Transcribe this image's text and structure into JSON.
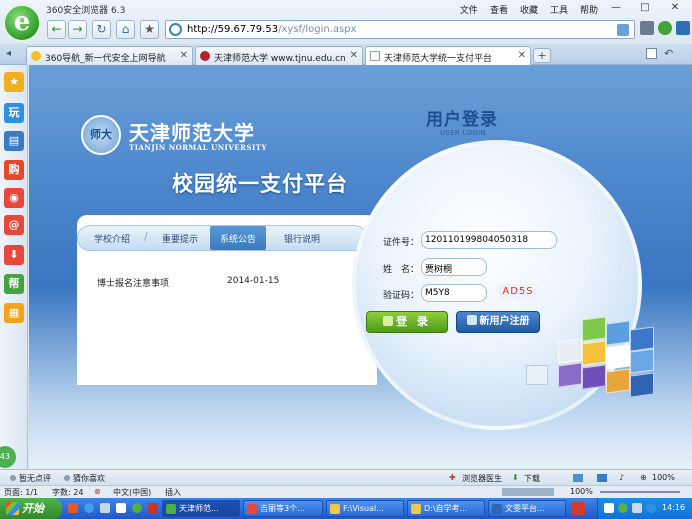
{
  "browser": {
    "app_name": "360安全浏览器 6.3",
    "logo_glyph": "e",
    "menus": [
      "文件",
      "查看",
      "收藏",
      "工具",
      "帮助"
    ],
    "win_buttons": [
      "—",
      "□",
      "✕"
    ],
    "url_host": "http://59.67.79.53",
    "url_path": "/xysf/login.aspx",
    "nav_glyphs": {
      "back": "←",
      "forward": "→",
      "refresh": "↻",
      "home": "⌂",
      "favorite": "★"
    }
  },
  "tabs": [
    {
      "label": "360导航_新一代安全上网导航",
      "close": "✕"
    },
    {
      "label": "天津师范大学 www.tjnu.edu.cn",
      "close": "✕"
    },
    {
      "label": "天津师范大学统一支付平台",
      "close": "✕"
    }
  ],
  "newtab_label": "+",
  "sidebar": {
    "items": [
      {
        "glyph": "★",
        "color": "#f2b01e"
      },
      {
        "glyph": "玩",
        "color": "#2f8fe0"
      },
      {
        "glyph": "▤",
        "color": "#3a7bc2"
      },
      {
        "glyph": "购",
        "color": "#e14b2b"
      },
      {
        "glyph": "◉",
        "color": "#e8483b"
      },
      {
        "glyph": "@",
        "color": "#e8483b"
      },
      {
        "glyph": "⬇",
        "color": "#e8483b"
      },
      {
        "glyph": "帮",
        "color": "#45a33d"
      },
      {
        "glyph": "▦",
        "color": "#f2a21e"
      }
    ],
    "badge": "43"
  },
  "page": {
    "emblem_text": "师大",
    "brand_cn": "天津师范大学",
    "brand_en": "TIANJIN NORMAL UNIVERSITY",
    "system_title": "校园统一支付平台",
    "panel_tabs": [
      "学校介绍",
      "重要提示",
      "系统公告",
      "银行说明"
    ],
    "panel_tab_separator": "/",
    "notices": [
      {
        "title": "博士报名注意事项",
        "date": "2014-01-15"
      }
    ]
  },
  "login": {
    "title": "用户登录",
    "subtitle": "USER LOGIN",
    "id_label": "证件号：",
    "id_value": "120110199804050318",
    "name_label": "姓　名：",
    "name_value": "贾树桐",
    "code_label": "验证码：",
    "code_value": "M5Y8",
    "captcha_text": "AD5S",
    "login_button": "登 录",
    "register_button": "新用户注册"
  },
  "statusbar": {
    "left1": "暂无点评",
    "left2": "猜你喜欢",
    "doctor": "浏览器医生",
    "download": "下载",
    "zoom": "100%"
  },
  "docbar": {
    "page": "页面: 1/1",
    "words": "字数: 24",
    "lang": "中文(中国)",
    "mode": "插入",
    "zoom": "100%"
  },
  "taskbar": {
    "start": "开始",
    "tasks": [
      "天津师范...",
      "吉丽等3个...",
      "F:\\Visual...",
      "D:\\自学考...",
      "文雯平台..."
    ],
    "clock": "14:16"
  }
}
